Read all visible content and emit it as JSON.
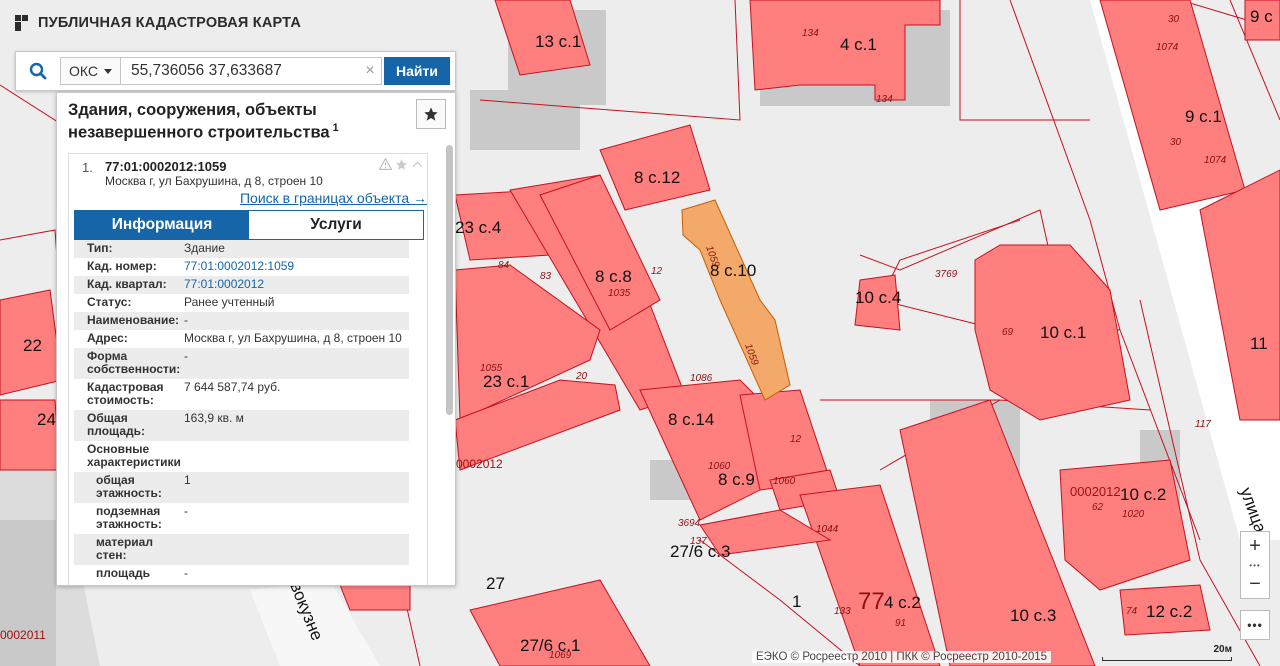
{
  "header": {
    "title": "ПУБЛИЧНАЯ КАДАСТРОВАЯ КАРТА"
  },
  "search": {
    "type_label": "ОКС",
    "query": "55,736056 37,633687",
    "clear_symbol": "×",
    "find_label": "Найти"
  },
  "panel": {
    "title": "Здания, сооружения, объекты незавершенного строительства",
    "count": "1",
    "result": {
      "index": "1.",
      "cad_number": "77:01:0002012:1059",
      "address": "Москва г, ул Бахрушина, д 8, строен 10",
      "search_link": "Поиск в границах объекта →"
    },
    "tabs": {
      "info": "Информация",
      "services": "Услуги"
    },
    "attributes": [
      {
        "key": "Тип:",
        "value": "Здание"
      },
      {
        "key": "Кад. номер:",
        "value": "77:01:0002012:1059",
        "link": true
      },
      {
        "key": "Кад. квартал:",
        "value": "77:01:0002012",
        "link": true
      },
      {
        "key": "Статус:",
        "value": "Ранее учтенный"
      },
      {
        "key": "Наименование:",
        "value": "-"
      },
      {
        "key": "Адрес:",
        "value": "Москва г, ул Бахрушина, д 8, строен 10"
      },
      {
        "key": "Форма собственности:",
        "value": "-"
      },
      {
        "key": "Кадастровая стоимость:",
        "value": "7 644 587,74 руб."
      },
      {
        "key": "Общая площадь:",
        "value": "163,9 кв. м"
      },
      {
        "key": "Основные характеристики",
        "value": ""
      },
      {
        "key": "общая этажность:",
        "value": "1",
        "sub": true
      },
      {
        "key": "подземная этажность:",
        "value": "-",
        "sub": true
      },
      {
        "key": "материал стен:",
        "value": "",
        "sub": true
      },
      {
        "key": "площадь",
        "value": "-",
        "sub": true
      }
    ]
  },
  "map": {
    "building_labels": [
      "13 с.1",
      "4 с.1",
      "9 с.1",
      "9 с",
      "8 с.12",
      "23 с.4",
      "8 с.8",
      "8 с.10",
      "10 с.4",
      "10 с.1",
      "22",
      "11",
      "23 с.1",
      "24",
      "8 с.14",
      "8 с.9",
      "10 с.2",
      "27/6 с.3",
      "27",
      "77",
      "4 с.2",
      "1",
      "10 с.3",
      "12 с.2",
      "27/6 с.1",
      "улица",
      "вокузне"
    ],
    "number_labels": [
      "134",
      "134",
      "1074",
      "30",
      "30",
      "1074",
      "83",
      "84",
      "1035",
      "12",
      "3769",
      "69",
      "1055",
      "20",
      "1086",
      "12",
      "117",
      "1060",
      "1060",
      "1044",
      "62",
      "1020",
      "133",
      "91",
      "74",
      "137",
      "3694",
      "1069",
      "1059",
      "1059"
    ],
    "parcel_labels": [
      "0002012",
      "0002012",
      "0002011"
    ]
  },
  "zoom": {
    "plus": "+",
    "minus": "−",
    "dots": "•••",
    "more": "•••"
  },
  "footer": {
    "attribution": "ЕЭКО © Росреестр 2010 | ПКК © Росреестр 2010-2015",
    "scale": "20м"
  },
  "colors": {
    "accent": "#1565a8",
    "building": "#ff7f7f",
    "selected": "#f3a96a",
    "parcel_line": "#c8101e"
  }
}
